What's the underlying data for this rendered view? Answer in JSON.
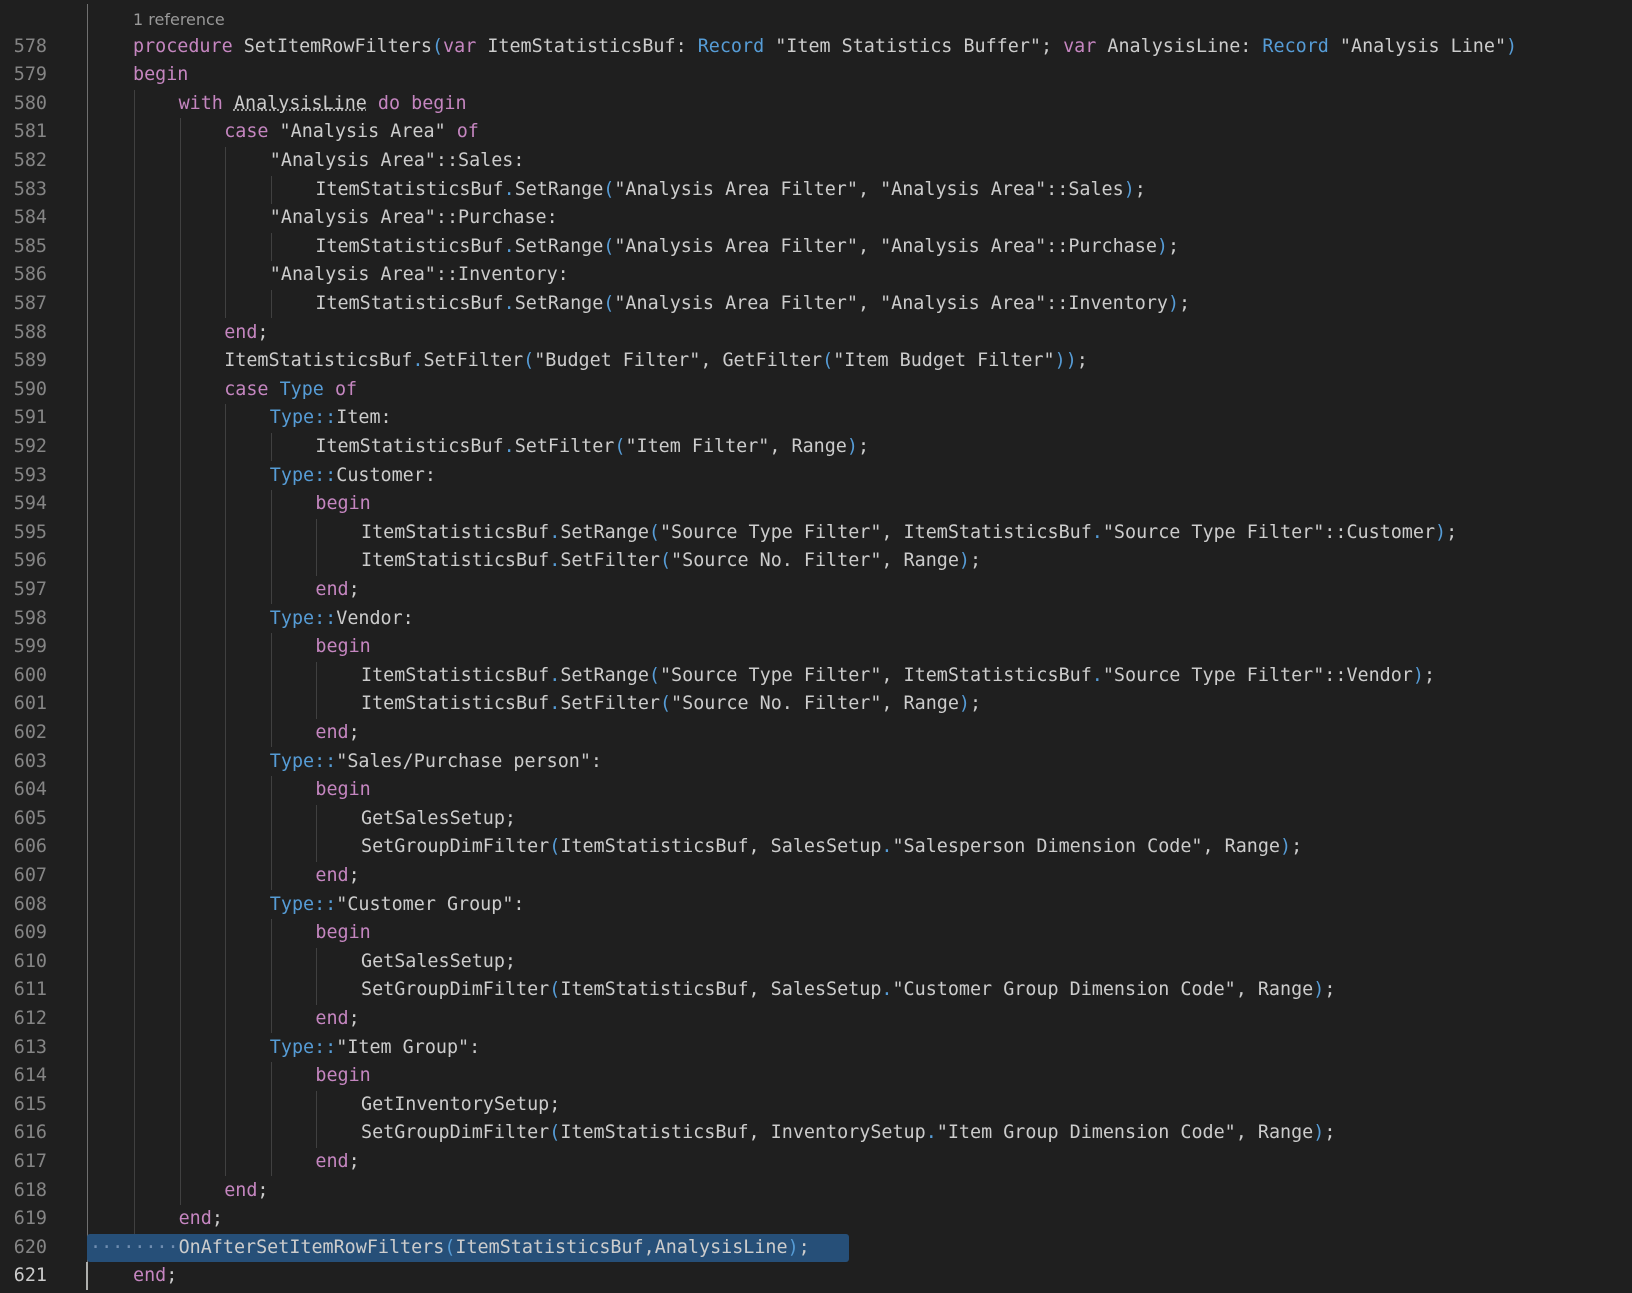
{
  "editor": {
    "codelens": "1 reference",
    "active_line": 621,
    "selected_line": 620,
    "lines": [
      {
        "n": 578,
        "indent": 0,
        "tokens": [
          [
            "k",
            "procedure"
          ],
          [
            "p",
            " SetItemRowFilters"
          ],
          [
            "o",
            "("
          ],
          [
            "k",
            "var"
          ],
          [
            "p",
            " ItemStatisticsBuf: "
          ],
          [
            "t",
            "Record"
          ],
          [
            "p",
            " \"Item Statistics Buffer\"; "
          ],
          [
            "k",
            "var"
          ],
          [
            "p",
            " AnalysisLine: "
          ],
          [
            "t",
            "Record"
          ],
          [
            "p",
            " \"Analysis Line\""
          ],
          [
            "o",
            ")"
          ]
        ]
      },
      {
        "n": 579,
        "indent": 0,
        "tokens": [
          [
            "k",
            "begin"
          ]
        ]
      },
      {
        "n": 580,
        "indent": 1,
        "tokens": [
          [
            "k",
            "with"
          ],
          [
            "p",
            " "
          ],
          [
            "u",
            "AnalysisLine"
          ],
          [
            "p",
            " "
          ],
          [
            "k",
            "do"
          ],
          [
            "p",
            " "
          ],
          [
            "k",
            "begin"
          ]
        ]
      },
      {
        "n": 581,
        "indent": 2,
        "tokens": [
          [
            "k",
            "case"
          ],
          [
            "p",
            " \"Analysis Area\" "
          ],
          [
            "k",
            "of"
          ]
        ]
      },
      {
        "n": 582,
        "indent": 3,
        "tokens": [
          [
            "p",
            "\"Analysis Area\"::Sales:"
          ]
        ]
      },
      {
        "n": 583,
        "indent": 4,
        "tokens": [
          [
            "p",
            "ItemStatisticsBuf"
          ],
          [
            "o",
            "."
          ],
          [
            "p",
            "SetRange"
          ],
          [
            "o",
            "("
          ],
          [
            "p",
            "\"Analysis Area Filter\", \"Analysis Area\"::Sales"
          ],
          [
            "o",
            ")"
          ],
          [
            "p",
            ";"
          ]
        ]
      },
      {
        "n": 584,
        "indent": 3,
        "tokens": [
          [
            "p",
            "\"Analysis Area\"::Purchase:"
          ]
        ]
      },
      {
        "n": 585,
        "indent": 4,
        "tokens": [
          [
            "p",
            "ItemStatisticsBuf"
          ],
          [
            "o",
            "."
          ],
          [
            "p",
            "SetRange"
          ],
          [
            "o",
            "("
          ],
          [
            "p",
            "\"Analysis Area Filter\", \"Analysis Area\"::Purchase"
          ],
          [
            "o",
            ")"
          ],
          [
            "p",
            ";"
          ]
        ]
      },
      {
        "n": 586,
        "indent": 3,
        "tokens": [
          [
            "p",
            "\"Analysis Area\"::Inventory:"
          ]
        ]
      },
      {
        "n": 587,
        "indent": 4,
        "tokens": [
          [
            "p",
            "ItemStatisticsBuf"
          ],
          [
            "o",
            "."
          ],
          [
            "p",
            "SetRange"
          ],
          [
            "o",
            "("
          ],
          [
            "p",
            "\"Analysis Area Filter\", \"Analysis Area\"::Inventory"
          ],
          [
            "o",
            ")"
          ],
          [
            "p",
            ";"
          ]
        ]
      },
      {
        "n": 588,
        "indent": 2,
        "tokens": [
          [
            "k",
            "end"
          ],
          [
            "p",
            ";"
          ]
        ]
      },
      {
        "n": 589,
        "indent": 2,
        "tokens": [
          [
            "p",
            "ItemStatisticsBuf"
          ],
          [
            "o",
            "."
          ],
          [
            "p",
            "SetFilter"
          ],
          [
            "o",
            "("
          ],
          [
            "p",
            "\"Budget Filter\", GetFilter"
          ],
          [
            "o",
            "("
          ],
          [
            "p",
            "\"Item Budget Filter\""
          ],
          [
            "o",
            "))"
          ],
          [
            "p",
            ";"
          ]
        ]
      },
      {
        "n": 590,
        "indent": 2,
        "tokens": [
          [
            "k",
            "case"
          ],
          [
            "p",
            " "
          ],
          [
            "t",
            "Type"
          ],
          [
            "p",
            " "
          ],
          [
            "k",
            "of"
          ]
        ]
      },
      {
        "n": 591,
        "indent": 3,
        "tokens": [
          [
            "t",
            "Type"
          ],
          [
            "o",
            "::"
          ],
          [
            "p",
            "Item:"
          ]
        ]
      },
      {
        "n": 592,
        "indent": 4,
        "tokens": [
          [
            "p",
            "ItemStatisticsBuf"
          ],
          [
            "o",
            "."
          ],
          [
            "p",
            "SetFilter"
          ],
          [
            "o",
            "("
          ],
          [
            "p",
            "\"Item Filter\", Range"
          ],
          [
            "o",
            ")"
          ],
          [
            "p",
            ";"
          ]
        ]
      },
      {
        "n": 593,
        "indent": 3,
        "tokens": [
          [
            "t",
            "Type"
          ],
          [
            "o",
            "::"
          ],
          [
            "p",
            "Customer:"
          ]
        ]
      },
      {
        "n": 594,
        "indent": 4,
        "tokens": [
          [
            "k",
            "begin"
          ]
        ]
      },
      {
        "n": 595,
        "indent": 5,
        "tokens": [
          [
            "p",
            "ItemStatisticsBuf"
          ],
          [
            "o",
            "."
          ],
          [
            "p",
            "SetRange"
          ],
          [
            "o",
            "("
          ],
          [
            "p",
            "\"Source Type Filter\", ItemStatisticsBuf"
          ],
          [
            "o",
            "."
          ],
          [
            "p",
            "\"Source Type Filter\"::Customer"
          ],
          [
            "o",
            ")"
          ],
          [
            "p",
            ";"
          ]
        ]
      },
      {
        "n": 596,
        "indent": 5,
        "tokens": [
          [
            "p",
            "ItemStatisticsBuf"
          ],
          [
            "o",
            "."
          ],
          [
            "p",
            "SetFilter"
          ],
          [
            "o",
            "("
          ],
          [
            "p",
            "\"Source No. Filter\", Range"
          ],
          [
            "o",
            ")"
          ],
          [
            "p",
            ";"
          ]
        ]
      },
      {
        "n": 597,
        "indent": 4,
        "tokens": [
          [
            "k",
            "end"
          ],
          [
            "p",
            ";"
          ]
        ]
      },
      {
        "n": 598,
        "indent": 3,
        "tokens": [
          [
            "t",
            "Type"
          ],
          [
            "o",
            "::"
          ],
          [
            "p",
            "Vendor:"
          ]
        ]
      },
      {
        "n": 599,
        "indent": 4,
        "tokens": [
          [
            "k",
            "begin"
          ]
        ]
      },
      {
        "n": 600,
        "indent": 5,
        "tokens": [
          [
            "p",
            "ItemStatisticsBuf"
          ],
          [
            "o",
            "."
          ],
          [
            "p",
            "SetRange"
          ],
          [
            "o",
            "("
          ],
          [
            "p",
            "\"Source Type Filter\", ItemStatisticsBuf"
          ],
          [
            "o",
            "."
          ],
          [
            "p",
            "\"Source Type Filter\"::Vendor"
          ],
          [
            "o",
            ")"
          ],
          [
            "p",
            ";"
          ]
        ]
      },
      {
        "n": 601,
        "indent": 5,
        "tokens": [
          [
            "p",
            "ItemStatisticsBuf"
          ],
          [
            "o",
            "."
          ],
          [
            "p",
            "SetFilter"
          ],
          [
            "o",
            "("
          ],
          [
            "p",
            "\"Source No. Filter\", Range"
          ],
          [
            "o",
            ")"
          ],
          [
            "p",
            ";"
          ]
        ]
      },
      {
        "n": 602,
        "indent": 4,
        "tokens": [
          [
            "k",
            "end"
          ],
          [
            "p",
            ";"
          ]
        ]
      },
      {
        "n": 603,
        "indent": 3,
        "tokens": [
          [
            "t",
            "Type"
          ],
          [
            "o",
            "::"
          ],
          [
            "p",
            "\"Sales/Purchase person\":"
          ]
        ]
      },
      {
        "n": 604,
        "indent": 4,
        "tokens": [
          [
            "k",
            "begin"
          ]
        ]
      },
      {
        "n": 605,
        "indent": 5,
        "tokens": [
          [
            "p",
            "GetSalesSetup;"
          ]
        ]
      },
      {
        "n": 606,
        "indent": 5,
        "tokens": [
          [
            "p",
            "SetGroupDimFilter"
          ],
          [
            "o",
            "("
          ],
          [
            "p",
            "ItemStatisticsBuf, SalesSetup"
          ],
          [
            "o",
            "."
          ],
          [
            "p",
            "\"Salesperson Dimension Code\", Range"
          ],
          [
            "o",
            ")"
          ],
          [
            "p",
            ";"
          ]
        ]
      },
      {
        "n": 607,
        "indent": 4,
        "tokens": [
          [
            "k",
            "end"
          ],
          [
            "p",
            ";"
          ]
        ]
      },
      {
        "n": 608,
        "indent": 3,
        "tokens": [
          [
            "t",
            "Type"
          ],
          [
            "o",
            "::"
          ],
          [
            "p",
            "\"Customer Group\":"
          ]
        ]
      },
      {
        "n": 609,
        "indent": 4,
        "tokens": [
          [
            "k",
            "begin"
          ]
        ]
      },
      {
        "n": 610,
        "indent": 5,
        "tokens": [
          [
            "p",
            "GetSalesSetup;"
          ]
        ]
      },
      {
        "n": 611,
        "indent": 5,
        "tokens": [
          [
            "p",
            "SetGroupDimFilter"
          ],
          [
            "o",
            "("
          ],
          [
            "p",
            "ItemStatisticsBuf, SalesSetup"
          ],
          [
            "o",
            "."
          ],
          [
            "p",
            "\"Customer Group Dimension Code\", Range"
          ],
          [
            "o",
            ")"
          ],
          [
            "p",
            ";"
          ]
        ]
      },
      {
        "n": 612,
        "indent": 4,
        "tokens": [
          [
            "k",
            "end"
          ],
          [
            "p",
            ";"
          ]
        ]
      },
      {
        "n": 613,
        "indent": 3,
        "tokens": [
          [
            "t",
            "Type"
          ],
          [
            "o",
            "::"
          ],
          [
            "p",
            "\"Item Group\":"
          ]
        ]
      },
      {
        "n": 614,
        "indent": 4,
        "tokens": [
          [
            "k",
            "begin"
          ]
        ]
      },
      {
        "n": 615,
        "indent": 5,
        "tokens": [
          [
            "p",
            "GetInventorySetup;"
          ]
        ]
      },
      {
        "n": 616,
        "indent": 5,
        "tokens": [
          [
            "p",
            "SetGroupDimFilter"
          ],
          [
            "o",
            "("
          ],
          [
            "p",
            "ItemStatisticsBuf, InventorySetup"
          ],
          [
            "o",
            "."
          ],
          [
            "p",
            "\"Item Group Dimension Code\", Range"
          ],
          [
            "o",
            ")"
          ],
          [
            "p",
            ";"
          ]
        ]
      },
      {
        "n": 617,
        "indent": 4,
        "tokens": [
          [
            "k",
            "end"
          ],
          [
            "p",
            ";"
          ]
        ]
      },
      {
        "n": 618,
        "indent": 2,
        "tokens": [
          [
            "k",
            "end"
          ],
          [
            "p",
            ";"
          ]
        ]
      },
      {
        "n": 619,
        "indent": 1,
        "tokens": [
          [
            "k",
            "end"
          ],
          [
            "p",
            ";"
          ]
        ]
      },
      {
        "n": 620,
        "indent": 1,
        "tokens": [
          [
            "p",
            "OnAfterSetItemRowFilters"
          ],
          [
            "o",
            "("
          ],
          [
            "p",
            "ItemStatisticsBuf,AnalysisLine"
          ],
          [
            "o",
            ")"
          ],
          [
            "p",
            ";"
          ]
        ]
      },
      {
        "n": 621,
        "indent": 0,
        "tokens": [
          [
            "k",
            "end"
          ],
          [
            "p",
            ";"
          ]
        ]
      }
    ]
  },
  "colors": {
    "background": "#1f1f1f",
    "keyword": "#c586c0",
    "type": "#569cd6",
    "plain": "#cccccc",
    "line_number": "#858585",
    "selection": "#264f78"
  }
}
